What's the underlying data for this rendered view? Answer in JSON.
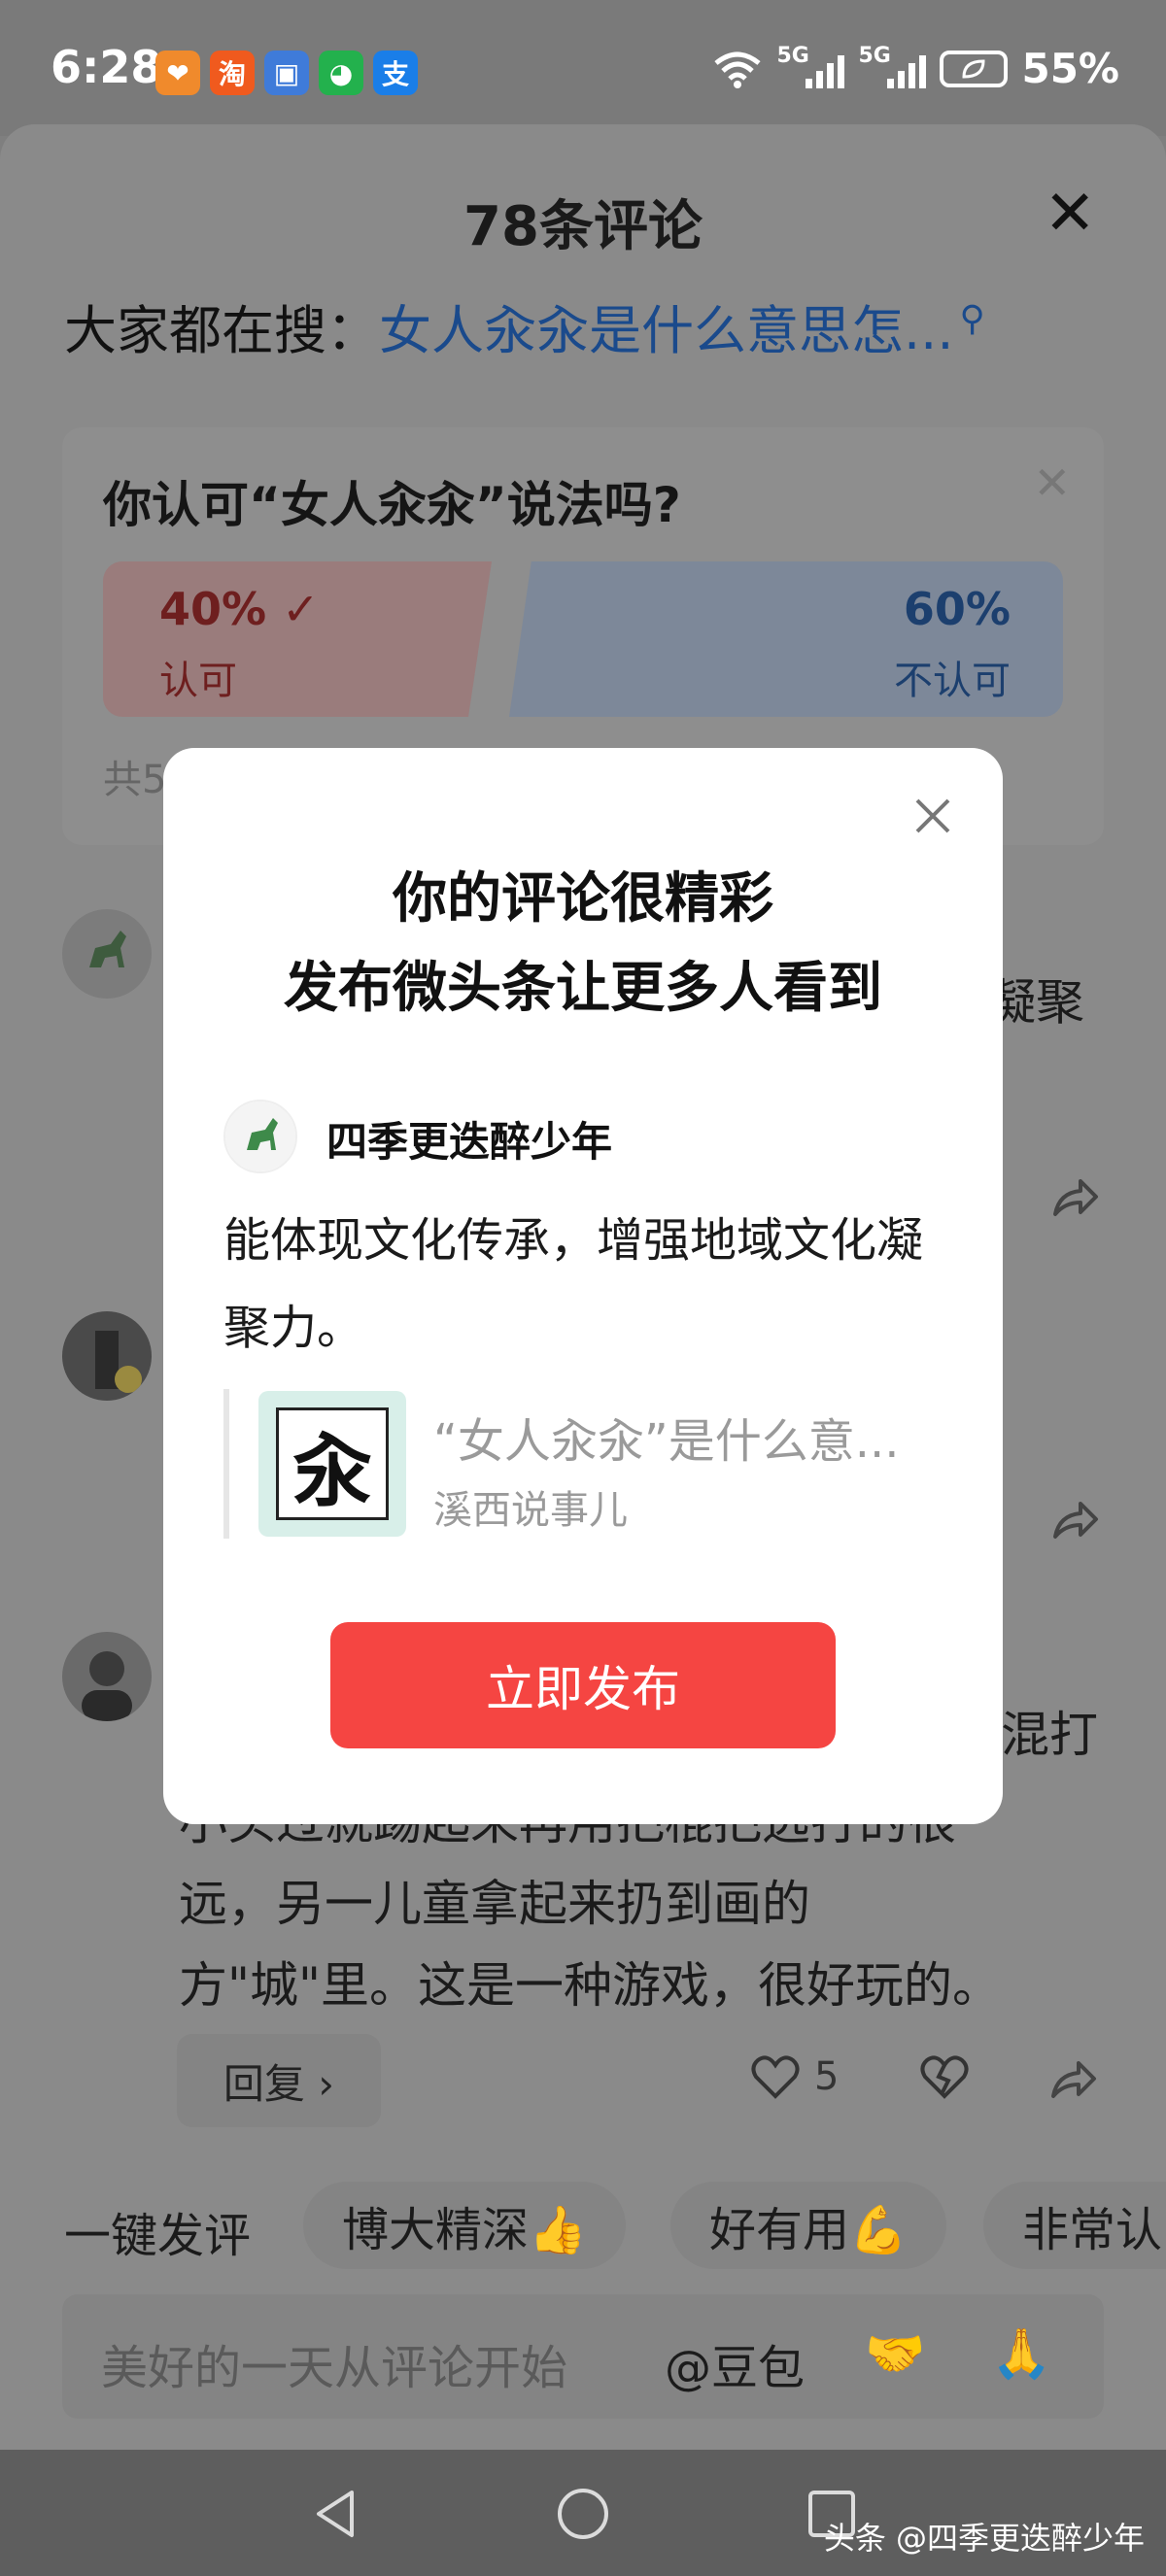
{
  "status_bar": {
    "time": "6:28",
    "apps": [
      {
        "icon": "heart-app-icon",
        "glyph": "❤",
        "color": "#f08a2c"
      },
      {
        "icon": "taobao-icon",
        "glyph": "淘",
        "color": "#f05a1e"
      },
      {
        "icon": "card-app-icon",
        "glyph": "▣",
        "color": "#3f7bd9"
      },
      {
        "icon": "wechat-icon",
        "glyph": "◕",
        "color": "#23b14d"
      },
      {
        "icon": "alipay-icon",
        "glyph": "支",
        "color": "#1a7ee8"
      }
    ],
    "sim1": "5G",
    "sim2": "5G",
    "battery": "55%"
  },
  "sheet": {
    "title": "78条评论",
    "hot_search_prefix": "大家都在搜：",
    "hot_search_link": "女人汆汆是什么意思怎...",
    "poll": {
      "question": "你认可“女人汆汆”说法吗?",
      "yes_pct": "40% ✓",
      "yes_label": "认可",
      "no_pct": "60%",
      "no_label": "不认可",
      "footer": "共5"
    },
    "comments": [
      {
        "text": "凝聚"
      },
      {
        "text": ""
      },
      {
        "text_line1": "混打",
        "text_line2": "小头过就踢起来再用把棍把远打的很",
        "text_line3": "远，另一儿童拿起来扔到画的",
        "text_line4": "方\"城\"里。这是一种游戏，很好玩的。",
        "reply_label": "回复 ›",
        "likes": "5"
      }
    ],
    "quick_label": "一键发评",
    "quick_chips": [
      "博大精深👍",
      "好有用💪",
      "非常认"
    ],
    "input_placeholder": "美好的一天从评论开始",
    "input_at": "@豆包",
    "input_emojis": [
      "🤝",
      "🙏"
    ]
  },
  "dialog": {
    "title_line1": "你的评论很精彩",
    "title_line2": "发布微头条让更多人看到",
    "username": "四季更迭醉少年",
    "body": "能体现文化传承，增强地域文化凝聚力。",
    "quote_char": "汆",
    "quote_title": "“女人汆汆”是什么意...",
    "quote_source": "溪西说事儿",
    "publish_label": "立即发布"
  },
  "watermark": "头条 @四季更迭醉少年"
}
